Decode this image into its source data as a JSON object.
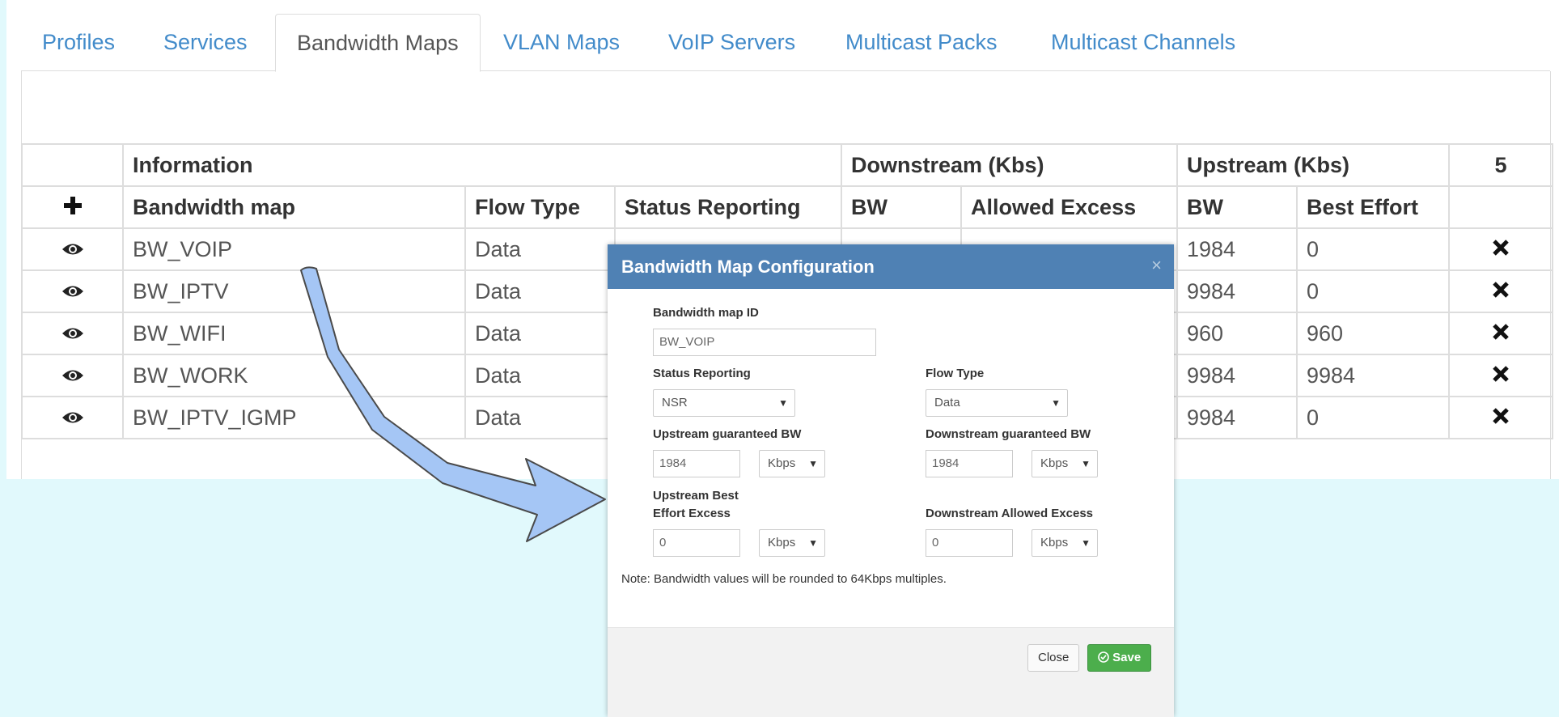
{
  "tabs": [
    {
      "label": "Profiles"
    },
    {
      "label": "Services"
    },
    {
      "label": "Bandwidth Maps"
    },
    {
      "label": "VLAN Maps"
    },
    {
      "label": "VoIP Servers"
    },
    {
      "label": "Multicast Packs"
    },
    {
      "label": "Multicast Channels"
    }
  ],
  "table": {
    "group_headers": {
      "information": "Information",
      "downstream": "Downstream (Kbs)",
      "upstream": "Upstream (Kbs)",
      "count": "5"
    },
    "columns": {
      "add": "+",
      "bandwidth_map": "Bandwidth map",
      "flow_type": "Flow Type",
      "status_reporting": "Status Reporting",
      "ds_bw": "BW",
      "ds_allowed_excess": "Allowed Excess",
      "us_bw": "BW",
      "us_best_effort": "Best Effort"
    },
    "rows": [
      {
        "name": "BW_VOIP",
        "flow": "Data",
        "us_bw": "1984",
        "best_effort": "0"
      },
      {
        "name": "BW_IPTV",
        "flow": "Data",
        "us_bw": "9984",
        "best_effort": "0"
      },
      {
        "name": "BW_WIFI",
        "flow": "Data",
        "us_bw": "960",
        "best_effort": "960"
      },
      {
        "name": "BW_WORK",
        "flow": "Data",
        "us_bw": "9984",
        "best_effort": "9984"
      },
      {
        "name": "BW_IPTV_IGMP",
        "flow": "Data",
        "us_bw": "9984",
        "best_effort": "0"
      }
    ]
  },
  "modal": {
    "title": "Bandwidth Map Configuration",
    "close_x": "×",
    "id_label": "Bandwidth map ID",
    "id_value": "BW_VOIP",
    "status_label": "Status Reporting",
    "status_value": "NSR",
    "flow_label": "Flow Type",
    "flow_value": "Data",
    "us_guaranteed_label": "Upstream guaranteed BW",
    "us_guaranteed_value": "1984",
    "ds_guaranteed_label": "Downstream guaranteed BW",
    "ds_guaranteed_value": "1984",
    "us_best_label_1": "Upstream Best",
    "us_best_label_2": "Effort Excess",
    "us_best_value": "0",
    "ds_allowed_label": "Downstream Allowed Excess",
    "ds_allowed_value": "0",
    "unit": "Kbps",
    "note": "Note: Bandwidth values will be rounded to 64Kbps multiples.",
    "close_button": "Close",
    "save_button": "Save"
  },
  "icons": {
    "eye": "eye-icon",
    "delete": "delete-icon",
    "add": "plus-icon",
    "save": "check-circle-icon"
  }
}
